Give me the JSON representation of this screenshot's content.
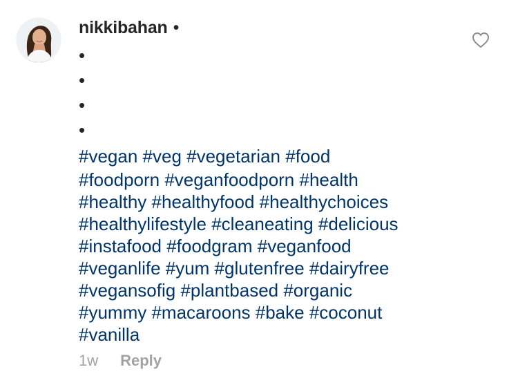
{
  "comment": {
    "username": "nikkibahan",
    "separator": "•",
    "bullets": [
      "•",
      "•",
      "•",
      "•"
    ],
    "hashtag_lines": [
      "#vegan #veg #vegetarian #food",
      "#foodporn #veganfoodporn #health",
      "#healthy #healthyfood #healthychoices",
      "#healthylifestyle #cleaneating #delicious",
      "#instafood #foodgram #veganfood",
      "#veganlife #yum #glutenfree #dairyfree",
      "#vegansofig #plantbased #organic",
      "#yummy #macaroons #bake #coconut",
      "#vanilla"
    ],
    "time": "1w",
    "reply_label": "Reply"
  },
  "icons": {
    "like": "heart-outline-icon",
    "avatar": "profile-photo"
  },
  "colors": {
    "text": "#262626",
    "hashtag": "#003569",
    "muted": "#a3a3a3",
    "icon": "#8e8e8e"
  }
}
